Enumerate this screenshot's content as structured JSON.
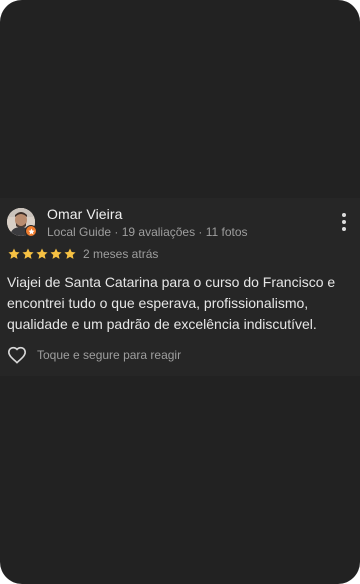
{
  "review": {
    "reviewer_name": "Omar Vieira",
    "reviewer_meta": "Local Guide · 19 avaliações · 11 fotos",
    "rating": 5,
    "rating_max": 5,
    "date": "2 meses atrás",
    "text": "Viajei de Santa Catarina para o curso do Francisco e encontrei tudo o que esperava, profissionalismo, qualidade e um padrão de excelência indiscutível.",
    "react_label": "Toque e segure para reagir"
  },
  "icons": {
    "more": "more-vert-icon",
    "star": "star-icon",
    "heart": "heart-outline-icon",
    "badge": "local-guide-badge-icon"
  },
  "colors": {
    "background": "#222222",
    "card": "#262626",
    "star": "#f6c143",
    "badge": "#ef7b2c",
    "primary_text": "#f1f1f1",
    "secondary_text": "#9e9e9e"
  }
}
